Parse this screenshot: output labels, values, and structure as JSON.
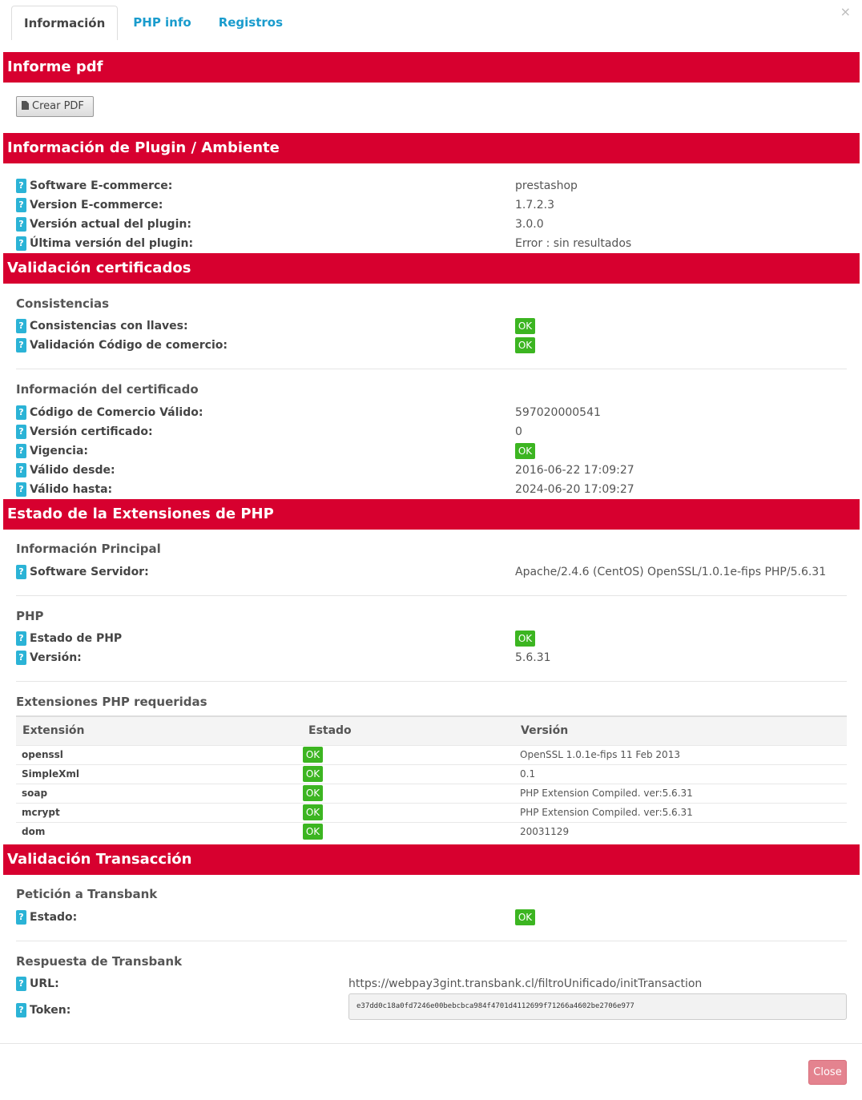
{
  "tabs": [
    "Información",
    "PHP info",
    "Registros"
  ],
  "close_x": "×",
  "sections": {
    "pdf": "Informe pdf",
    "plugin": "Información de Plugin / Ambiente",
    "certs": "Validación certificados",
    "php_ext": "Estado de la Extensiones de PHP",
    "tx": "Validación Transacción"
  },
  "create_pdf_label": "Crear PDF",
  "help_glyph": "?",
  "ok_label": "OK",
  "plugin_rows": [
    {
      "label": "Software E-commerce:",
      "value": "prestashop"
    },
    {
      "label": "Version E-commerce:",
      "value": "1.7.2.3"
    },
    {
      "label": "Versión actual del plugin:",
      "value": "3.0.0"
    },
    {
      "label": "Última versión del plugin:",
      "value": "Error : sin resultados"
    }
  ],
  "consistencias": {
    "title": "Consistencias",
    "rows": [
      {
        "label": "Consistencias con llaves:"
      },
      {
        "label": "Validación Código de comercio:"
      }
    ]
  },
  "cert_info": {
    "title": "Información del certificado",
    "rows": [
      {
        "label": "Código de Comercio Válido:",
        "value": "597020000541"
      },
      {
        "label": "Versión certificado:",
        "value": "0"
      },
      {
        "label": "Vigencia:"
      },
      {
        "label": "Válido desde:",
        "value": "2016-06-22 17:09:27"
      },
      {
        "label": "Válido hasta:",
        "value": "2024-06-20 17:09:27"
      }
    ]
  },
  "info_principal": {
    "title": "Información Principal",
    "rows": [
      {
        "label": "Software Servidor:",
        "value": "Apache/2.4.6 (CentOS) OpenSSL/1.0.1e-fips PHP/5.6.31"
      }
    ]
  },
  "php": {
    "title": "PHP",
    "rows": [
      {
        "label": "Estado de PHP"
      },
      {
        "label": "Versión:",
        "value": "5.6.31"
      }
    ]
  },
  "extensions": {
    "title": "Extensiones PHP requeridas",
    "headers": [
      "Extensión",
      "Estado",
      "Versión"
    ],
    "rows": [
      {
        "name": "openssl",
        "version": "OpenSSL 1.0.1e-fips 11 Feb 2013"
      },
      {
        "name": "SimpleXml",
        "version": "0.1"
      },
      {
        "name": "soap",
        "version": "PHP Extension Compiled. ver:5.6.31"
      },
      {
        "name": "mcrypt",
        "version": "PHP Extension Compiled. ver:5.6.31"
      },
      {
        "name": "dom",
        "version": "20031129"
      }
    ]
  },
  "peticion": {
    "title": "Petición a Transbank",
    "rows": [
      {
        "label": "Estado:"
      }
    ]
  },
  "respuesta": {
    "title": "Respuesta de Transbank",
    "url_label": "URL:",
    "url_value": "https://webpay3gint.transbank.cl/filtroUnificado/initTransaction",
    "token_label": "Token:",
    "token_value": "e37dd0c18a0fd7246e00bebcbca984f4701d4112699f71266a4602be2706e977"
  },
  "close_button": "Close",
  "colors": {
    "section_header": "#d7002f",
    "ok_badge": "#3cb521",
    "help_icon": "#2bb3d6",
    "link": "#1a9ccd",
    "close_button": "#e4838f"
  }
}
